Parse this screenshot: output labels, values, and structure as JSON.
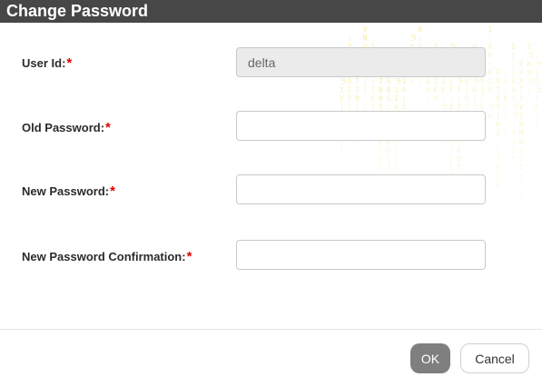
{
  "dialog": {
    "title": "Change Password"
  },
  "form": {
    "required_mark": "*",
    "user_id": {
      "label": "User Id:",
      "value": "delta",
      "disabled": true
    },
    "old_password": {
      "label": "Old Password:",
      "value": ""
    },
    "new_password": {
      "label": "New Password:",
      "value": ""
    },
    "new_password_confirmation": {
      "label": "New Password Confirmation:",
      "value": ""
    }
  },
  "buttons": {
    "ok": "OK",
    "cancel": "Cancel"
  },
  "colors": {
    "titlebar": "#474747",
    "required": "#e00000",
    "ok_button": "#7f7f7f",
    "matrix_glyphs": "#f2e06a"
  }
}
